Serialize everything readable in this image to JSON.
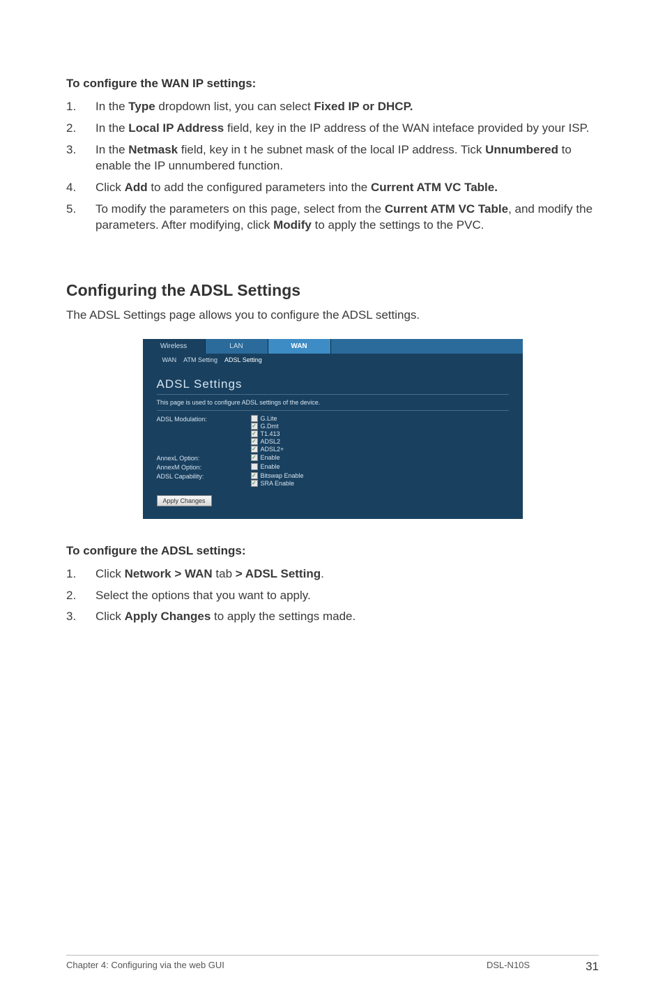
{
  "headings": {
    "wan_ip": "To configure the WAN IP settings:",
    "adsl_main": "Configuring the ADSL Settings",
    "adsl_desc": "The ADSL Settings page allows you to configure the ADSL settings.",
    "adsl_settings": "To configure the ADSL settings:"
  },
  "wan_steps": [
    {
      "num": "1.",
      "pre": "In the ",
      "b1": "Type",
      "mid": " dropdown list, you can select ",
      "b2": "Fixed IP or DHCP."
    },
    {
      "num": "2.",
      "pre": "In the ",
      "b1": "Local IP Address",
      "mid": " field, key in the IP address of the WAN inteface provided by your ISP."
    },
    {
      "num": "3.",
      "pre": "In the ",
      "b1": "Netmask",
      "mid": " field, key in t he subnet mask of the local IP address. Tick ",
      "b2": "Unnumbered",
      "post": " to enable the IP unnumbered function."
    },
    {
      "num": "4.",
      "pre": "Click ",
      "b1": "Add",
      "mid": " to add the configured parameters into the ",
      "b2": "Current ATM VC Table."
    },
    {
      "num": "5.",
      "pre": "To modify the parameters on this page, select from the ",
      "b1": "Current ATM VC Table",
      "mid": ", and modify the parameters. After modifying, click ",
      "b2": "Modify",
      "post": " to apply the settings to the PVC."
    }
  ],
  "adsl_steps": [
    {
      "num": "1.",
      "pre": "Click ",
      "b1": "Network > WAN",
      "mid": " tab ",
      "b2": "> ADSL Setting",
      "post": "."
    },
    {
      "num": "2.",
      "text": "Select the options that you want to apply."
    },
    {
      "num": "3.",
      "pre": "Click ",
      "b1": "Apply Changes",
      "post": " to apply the settings made."
    }
  ],
  "screenshot": {
    "tabs": {
      "wireless": "Wireless",
      "lan": "LAN",
      "wan": "WAN"
    },
    "subtabs": {
      "wan": "WAN",
      "atm": "ATM Setting",
      "adsl": "ADSL Setting"
    },
    "title": "ADSL Settings",
    "desc": "This page is used to configure ADSL settings of the device.",
    "labels": {
      "modulation": "ADSL Modulation:",
      "annexl": "AnnexL Option:",
      "annexm": "AnnexM Option:",
      "capability": "ADSL Capability:"
    },
    "options": {
      "glite": "G.Lite",
      "gdmt": "G.Dmt",
      "t1413": "T1.413",
      "adsl2": "ADSL2",
      "adsl2p": "ADSL2+",
      "enable": "Enable",
      "bitswap": "Bitswap Enable",
      "sra": "SRA Enable"
    },
    "apply": "Apply Changes"
  },
  "checks": {
    "glite": false,
    "gdmt": true,
    "t1413": true,
    "adsl2": true,
    "adsl2p": true,
    "annexl_enable": true,
    "annexm_enable": false,
    "bitswap": true,
    "sra": true
  },
  "footer": {
    "left": "Chapter 4: Configuring via the web GUI",
    "model": "DSL-N10S",
    "page": "31"
  }
}
